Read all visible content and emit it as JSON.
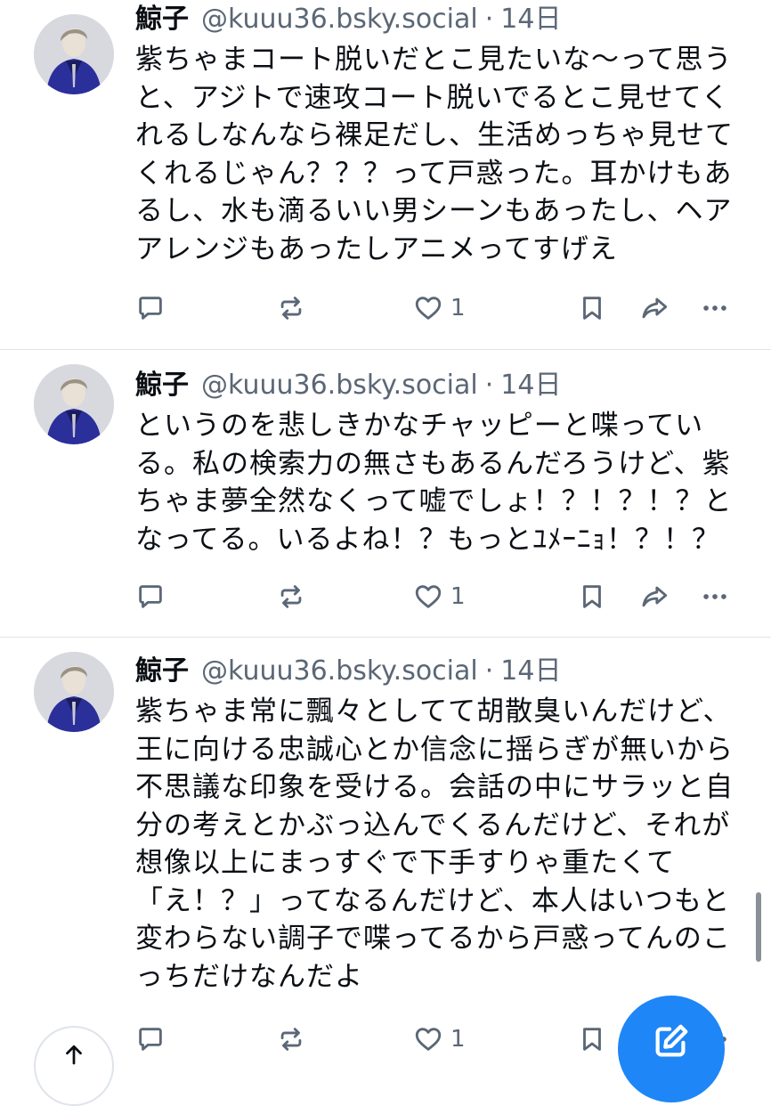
{
  "posts": [
    {
      "author": {
        "display_name": "鯨子",
        "handle": "@kuuu36.bsky.social",
        "timestamp": "14日"
      },
      "text": "紫ちゃまコート脱いだとこ見たいな〜って思うと、アジトで速攻コート脱いでるとこ見せてくれるしなんなら裸足だし、生活めっちゃ見せてくれるじゃん？？？って戸惑った。耳かけもあるし、水も滴るいい男シーンもあったし、ヘアアレンジもあったしアニメってすげえ",
      "like_count": "1"
    },
    {
      "author": {
        "display_name": "鯨子",
        "handle": "@kuuu36.bsky.social",
        "timestamp": "14日"
      },
      "text": "というのを悲しきかなチャッピーと喋っている。私の検索力の無さもあるんだろうけど、紫ちゃま夢全然なくって嘘でしょ！？！？！？となってる。いるよね！？もっとﾕﾒｰﾆｮ！？！？",
      "like_count": "1"
    },
    {
      "author": {
        "display_name": "鯨子",
        "handle": "@kuuu36.bsky.social",
        "timestamp": "14日"
      },
      "text": "紫ちゃま常に飄々としてて胡散臭いんだけど、王に向ける忠誠心とか信念に揺らぎが無いから不思議な印象を受ける。会話の中にサラッと自分の考えとかぶっ込んでくるんだけど、それが想像以上にまっすぐで下手すりゃ重たくて「え！？」ってなるんだけど、本人はいつもと変わらない調子で喋ってるから戸惑ってんのこっちだけなんだよ",
      "like_count": "1"
    }
  ],
  "icons": {
    "reply": "reply-icon",
    "repost": "repost-icon",
    "like": "heart-icon",
    "bookmark": "bookmark-icon",
    "share": "share-icon",
    "more": "more-icon",
    "compose": "compose-icon",
    "scroll_top": "arrow-up-icon"
  },
  "colors": {
    "accent": "#1e86f6",
    "muted_text": "#5b6776",
    "avatar_coat": "#2b2f9a"
  }
}
